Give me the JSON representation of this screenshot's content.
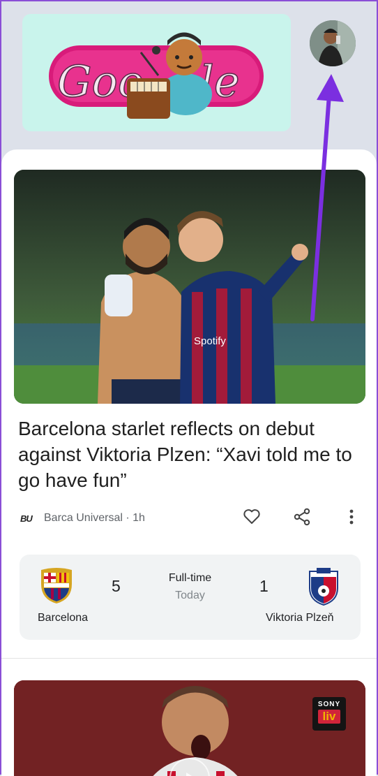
{
  "header": {
    "doodle_alt": "Google",
    "avatar_label": "Account"
  },
  "article": {
    "headline": "Barcelona starlet reflects on debut against Viktoria Plzen: “Xavi told me to go have fun”",
    "source_logo": "BU",
    "source": "Barca Universal · 1h",
    "actions": [
      "like",
      "share",
      "more"
    ]
  },
  "scoreboard": {
    "home_team": "Barcelona",
    "home_score": "5",
    "away_team": "Viktoria Plzeň",
    "away_score": "1",
    "status": "Full-time",
    "when": "Today"
  },
  "next_card": {
    "badge_top": "SONY",
    "badge_bottom": "liv"
  },
  "colors": {
    "accent_arrow": "#7b2fe0",
    "background": "#dde1ea",
    "card": "#ffffff"
  }
}
